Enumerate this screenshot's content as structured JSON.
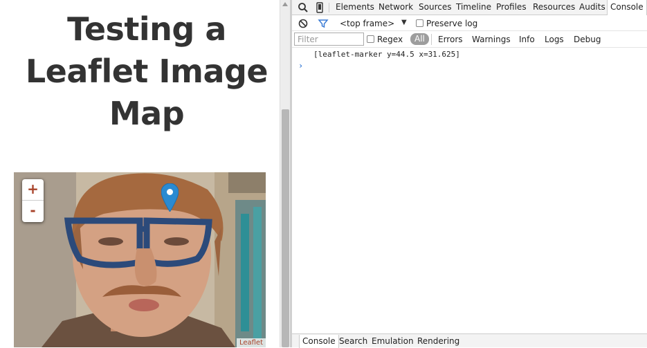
{
  "page": {
    "title_lines": [
      "Testing a",
      "Leaflet Image",
      "Map"
    ]
  },
  "map": {
    "zoom_in": "+",
    "zoom_out": "-",
    "attribution": "Leaflet",
    "accent_color": "#a8432a",
    "marker_color": "#2a8ad1"
  },
  "devtools": {
    "tabs": [
      "Elements",
      "Network",
      "Sources",
      "Timeline",
      "Profiles",
      "Resources",
      "Audits",
      "Console"
    ],
    "active_tab": "Console",
    "frame_select": "<top frame>",
    "preserve_log": "Preserve log",
    "filter_placeholder": "Filter",
    "regex": "Regex",
    "levels": [
      "All",
      "Errors",
      "Warnings",
      "Info",
      "Logs",
      "Debug"
    ],
    "log_message": "[leaflet-marker y=44.5 x=31.625]",
    "prompt": "›",
    "drawer_tabs": [
      "Console",
      "Search",
      "Emulation",
      "Rendering"
    ],
    "icons": [
      "search-icon",
      "device-mode-icon",
      "clear-console-icon",
      "filter-icon"
    ]
  }
}
